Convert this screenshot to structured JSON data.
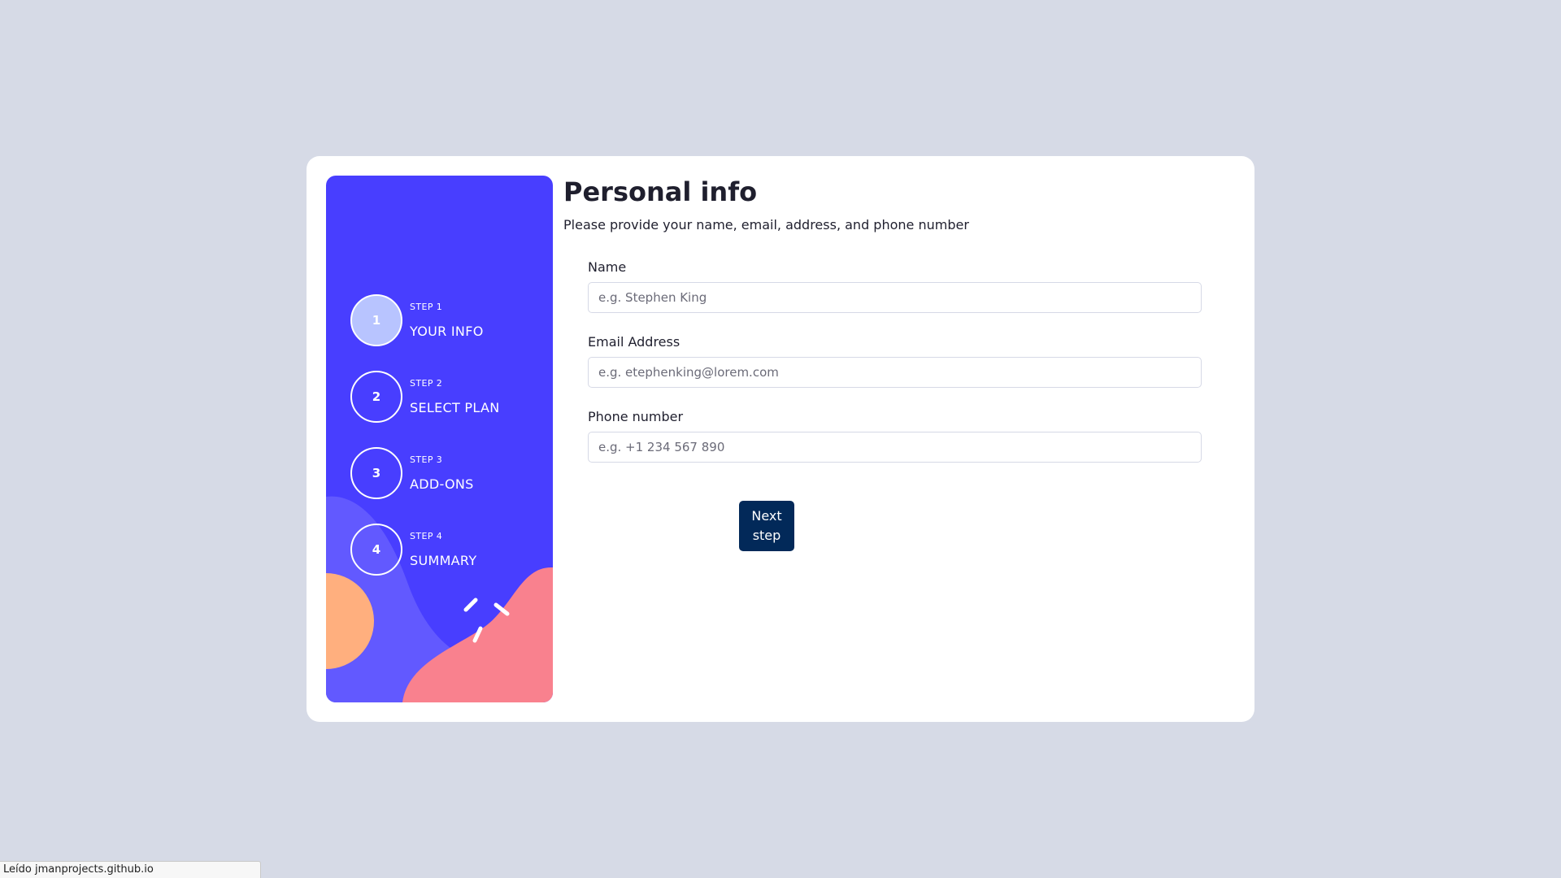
{
  "colors": {
    "page_background": "#d6dae6",
    "sidebar_background": "#483eff",
    "active_step": "#b8c4ff",
    "button_background": "#022959",
    "deco_orange": "#ffaf7e",
    "deco_pink": "#f9818e",
    "deco_purple": "#6259ff"
  },
  "sidebar": {
    "steps": [
      {
        "number": "1",
        "step_label": "STEP 1",
        "title": "YOUR INFO",
        "active": true
      },
      {
        "number": "2",
        "step_label": "STEP 2",
        "title": "SELECT PLAN",
        "active": false
      },
      {
        "number": "3",
        "step_label": "STEP 3",
        "title": "ADD-ONS",
        "active": false
      },
      {
        "number": "4",
        "step_label": "STEP 4",
        "title": "SUMMARY",
        "active": false
      }
    ]
  },
  "main": {
    "title": "Personal info",
    "subtitle": "Please provide your name, email, address, and phone number",
    "fields": {
      "name": {
        "label": "Name",
        "placeholder": "e.g. Stephen King",
        "value": ""
      },
      "email": {
        "label": "Email Address",
        "placeholder": "e.g. etephenking@lorem.com",
        "value": ""
      },
      "phone": {
        "label": "Phone number",
        "placeholder": "e.g. +1 234 567 890",
        "value": ""
      }
    },
    "next_button_label": "Next step"
  },
  "status_bar": {
    "text": "Leído jmanprojects.github.io"
  }
}
